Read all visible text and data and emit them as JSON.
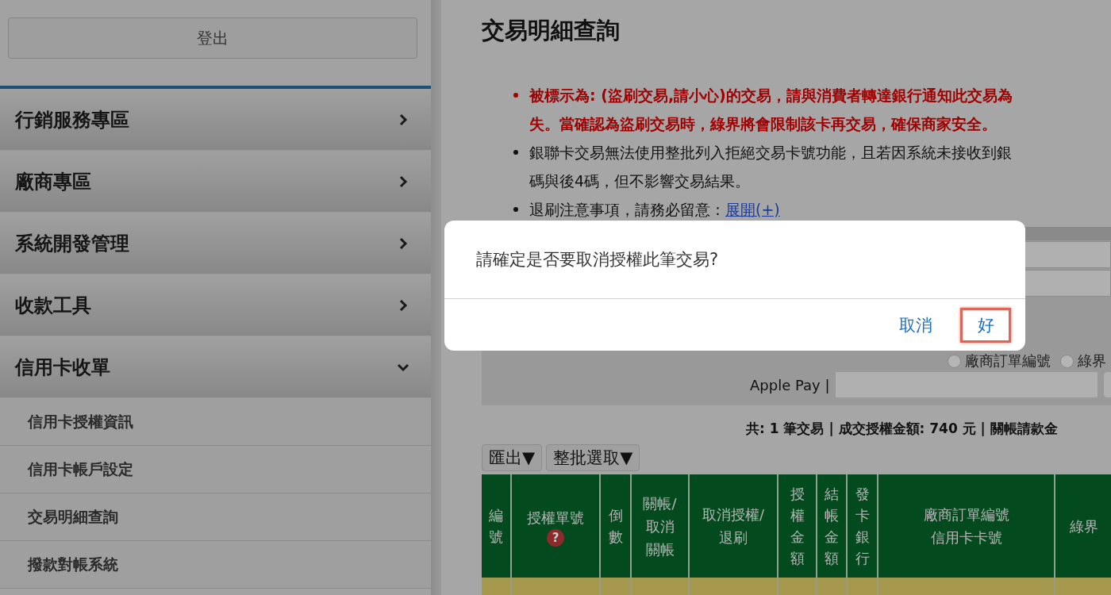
{
  "sidebar": {
    "logout_button": "登出",
    "menu": [
      {
        "label": "行銷服務專區",
        "expanded": false
      },
      {
        "label": "廠商專區",
        "expanded": false
      },
      {
        "label": "系統開發管理",
        "expanded": false
      },
      {
        "label": "收款工具",
        "expanded": false
      },
      {
        "label": "信用卡收單",
        "expanded": true,
        "children": [
          {
            "label": "信用卡授權資訊"
          },
          {
            "label": "信用卡帳戶設定"
          },
          {
            "label": "交易明細查詢"
          },
          {
            "label": "撥款對帳系統"
          }
        ]
      }
    ]
  },
  "page": {
    "title": "交易明細查詢",
    "notes": [
      {
        "kind": "warning",
        "lines": [
          "被標示為: (盜刷交易,請小心)的交易，請與消費者轉達銀行通知此交易為",
          "失。當確認為盜刷交易時，綠界將會限制該卡再交易，確保商家安全。"
        ]
      },
      {
        "kind": "normal",
        "lines": [
          "銀聯卡交易無法使用整批列入拒絕交易卡號功能，且若因系統未接收到銀",
          "碼與後4碼，但不影響交易結果。"
        ]
      },
      {
        "kind": "normal",
        "lines": [
          "退刷注意事項，請務必留意："
        ],
        "link": "展開(+)"
      }
    ],
    "search_panel": {
      "radio_options": [
        {
          "label": "廠商訂單編號",
          "selected": false
        },
        {
          "label": "綠界",
          "selected": false
        }
      ],
      "apple_pay_label": "Apple Pay |"
    },
    "summary": "共: 1 筆交易 | 成交授權金額: 740 元 | 關帳請款金",
    "toolbar": [
      "匯出▼",
      "整批選取▼"
    ],
    "table": {
      "columns": [
        {
          "kind": "vertical",
          "lines": [
            "編號"
          ]
        },
        {
          "kind": "stacked",
          "lines": [
            "授權單號"
          ],
          "help": "?"
        },
        {
          "kind": "vertical",
          "lines": [
            "倒數"
          ]
        },
        {
          "kind": "stacked",
          "lines": [
            "關帳/",
            "取消",
            "關帳"
          ]
        },
        {
          "kind": "stacked",
          "lines": [
            "取消授權/",
            "退刷"
          ]
        },
        {
          "kind": "vertical",
          "lines": [
            "授權金額"
          ]
        },
        {
          "kind": "vertical",
          "lines": [
            "結帳金額"
          ]
        },
        {
          "kind": "vertical",
          "lines": [
            "發卡銀行"
          ]
        },
        {
          "kind": "stacked",
          "lines": [
            "廠商訂單編號",
            "信用卡卡號"
          ]
        },
        {
          "kind": "stacked",
          "lines": [
            "綠界"
          ]
        }
      ]
    }
  },
  "dialog": {
    "message": "請確定是否要取消授權此筆交易?",
    "buttons": [
      {
        "label": "取消",
        "highlighted": false
      },
      {
        "label": "好",
        "highlighted": true
      }
    ]
  }
}
